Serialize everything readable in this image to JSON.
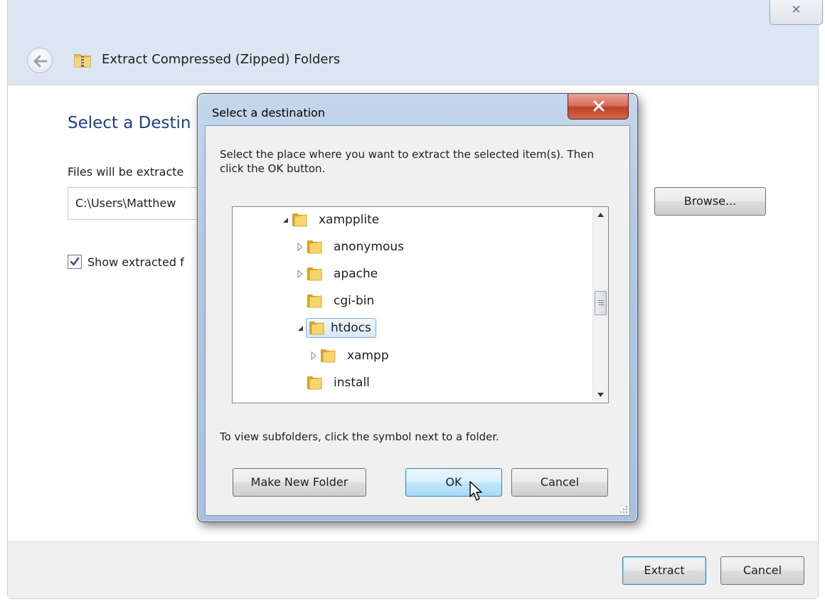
{
  "wizard": {
    "close_glyph": "✕",
    "title": "Extract Compressed (Zipped) Folders",
    "heading": "Select a Destin",
    "files_label": "Files will be extracte",
    "path_value": "C:\\Users\\Matthew",
    "browse_label": "Browse...",
    "show_extracted_label": "Show extracted f",
    "show_extracted_checked": true,
    "extract_label": "Extract",
    "cancel_label": "Cancel"
  },
  "dialog": {
    "title": "Select a destination",
    "instruction": "Select the place where you want to extract the selected item(s).  Then click the OK button.",
    "hint": "To view subfolders, click the symbol next to a folder.",
    "tree": [
      {
        "label": "xampplite",
        "expander": "expanded"
      },
      {
        "label": "anonymous",
        "expander": "collapsed"
      },
      {
        "label": "apache",
        "expander": "collapsed"
      },
      {
        "label": "cgi-bin",
        "expander": "none"
      },
      {
        "label": "htdocs",
        "expander": "expanded",
        "selected": true
      },
      {
        "label": "xampp",
        "expander": "collapsed"
      },
      {
        "label": "install",
        "expander": "none"
      }
    ],
    "make_new_folder_label": "Make New Folder",
    "ok_label": "OK",
    "cancel_label": "Cancel"
  },
  "icons": {
    "back": "back-arrow-icon",
    "zip_folder": "zip-folder-icon",
    "folder": "folder-icon",
    "close": "close-icon",
    "cursor": "mouse-pointer-icon"
  },
  "colors": {
    "heading_blue": "#1e3f8a",
    "close_red": "#c2402a",
    "selection_border": "#84acdd"
  }
}
